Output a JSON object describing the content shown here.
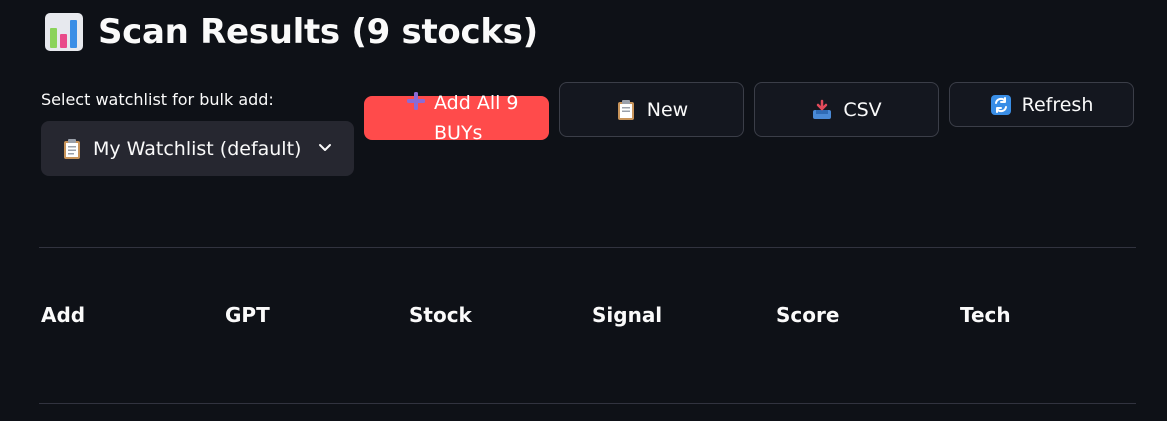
{
  "page": {
    "title": "Scan Results (9 stocks)",
    "title_icon": "bar-chart-icon"
  },
  "watchlist": {
    "label": "Select watchlist for bulk add:",
    "selected": "My Watchlist (default)",
    "icon": "clipboard-icon"
  },
  "buttons": {
    "add_all": "Add All 9 BUYs",
    "new": "New",
    "csv": "CSV",
    "refresh": "Refresh"
  },
  "table": {
    "columns": [
      "Add",
      "GPT",
      "Stock",
      "Signal",
      "Score",
      "Tech"
    ]
  },
  "colors": {
    "background": "#0e1117",
    "primary_button": "#ff4b4b",
    "select_bg": "#262730"
  }
}
